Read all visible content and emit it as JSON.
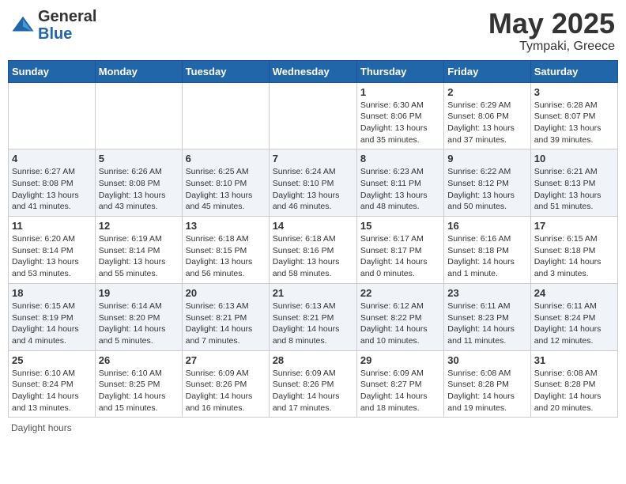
{
  "header": {
    "logo_general": "General",
    "logo_blue": "Blue",
    "title": "May 2025",
    "location": "Tympaki, Greece"
  },
  "days_of_week": [
    "Sunday",
    "Monday",
    "Tuesday",
    "Wednesday",
    "Thursday",
    "Friday",
    "Saturday"
  ],
  "footer": "Daylight hours",
  "weeks": [
    [
      {
        "date": "",
        "sunrise": "",
        "sunset": "",
        "daylight": ""
      },
      {
        "date": "",
        "sunrise": "",
        "sunset": "",
        "daylight": ""
      },
      {
        "date": "",
        "sunrise": "",
        "sunset": "",
        "daylight": ""
      },
      {
        "date": "",
        "sunrise": "",
        "sunset": "",
        "daylight": ""
      },
      {
        "date": "1",
        "sunrise": "Sunrise: 6:30 AM",
        "sunset": "Sunset: 8:06 PM",
        "daylight": "Daylight: 13 hours and 35 minutes."
      },
      {
        "date": "2",
        "sunrise": "Sunrise: 6:29 AM",
        "sunset": "Sunset: 8:06 PM",
        "daylight": "Daylight: 13 hours and 37 minutes."
      },
      {
        "date": "3",
        "sunrise": "Sunrise: 6:28 AM",
        "sunset": "Sunset: 8:07 PM",
        "daylight": "Daylight: 13 hours and 39 minutes."
      }
    ],
    [
      {
        "date": "4",
        "sunrise": "Sunrise: 6:27 AM",
        "sunset": "Sunset: 8:08 PM",
        "daylight": "Daylight: 13 hours and 41 minutes."
      },
      {
        "date": "5",
        "sunrise": "Sunrise: 6:26 AM",
        "sunset": "Sunset: 8:08 PM",
        "daylight": "Daylight: 13 hours and 43 minutes."
      },
      {
        "date": "6",
        "sunrise": "Sunrise: 6:25 AM",
        "sunset": "Sunset: 8:10 PM",
        "daylight": "Daylight: 13 hours and 45 minutes."
      },
      {
        "date": "7",
        "sunrise": "Sunrise: 6:24 AM",
        "sunset": "Sunset: 8:10 PM",
        "daylight": "Daylight: 13 hours and 46 minutes."
      },
      {
        "date": "8",
        "sunrise": "Sunrise: 6:23 AM",
        "sunset": "Sunset: 8:11 PM",
        "daylight": "Daylight: 13 hours and 48 minutes."
      },
      {
        "date": "9",
        "sunrise": "Sunrise: 6:22 AM",
        "sunset": "Sunset: 8:12 PM",
        "daylight": "Daylight: 13 hours and 50 minutes."
      },
      {
        "date": "10",
        "sunrise": "Sunrise: 6:21 AM",
        "sunset": "Sunset: 8:13 PM",
        "daylight": "Daylight: 13 hours and 51 minutes."
      }
    ],
    [
      {
        "date": "11",
        "sunrise": "Sunrise: 6:20 AM",
        "sunset": "Sunset: 8:14 PM",
        "daylight": "Daylight: 13 hours and 53 minutes."
      },
      {
        "date": "12",
        "sunrise": "Sunrise: 6:19 AM",
        "sunset": "Sunset: 8:14 PM",
        "daylight": "Daylight: 13 hours and 55 minutes."
      },
      {
        "date": "13",
        "sunrise": "Sunrise: 6:18 AM",
        "sunset": "Sunset: 8:15 PM",
        "daylight": "Daylight: 13 hours and 56 minutes."
      },
      {
        "date": "14",
        "sunrise": "Sunrise: 6:18 AM",
        "sunset": "Sunset: 8:16 PM",
        "daylight": "Daylight: 13 hours and 58 minutes."
      },
      {
        "date": "15",
        "sunrise": "Sunrise: 6:17 AM",
        "sunset": "Sunset: 8:17 PM",
        "daylight": "Daylight: 14 hours and 0 minutes."
      },
      {
        "date": "16",
        "sunrise": "Sunrise: 6:16 AM",
        "sunset": "Sunset: 8:18 PM",
        "daylight": "Daylight: 14 hours and 1 minute."
      },
      {
        "date": "17",
        "sunrise": "Sunrise: 6:15 AM",
        "sunset": "Sunset: 8:18 PM",
        "daylight": "Daylight: 14 hours and 3 minutes."
      }
    ],
    [
      {
        "date": "18",
        "sunrise": "Sunrise: 6:15 AM",
        "sunset": "Sunset: 8:19 PM",
        "daylight": "Daylight: 14 hours and 4 minutes."
      },
      {
        "date": "19",
        "sunrise": "Sunrise: 6:14 AM",
        "sunset": "Sunset: 8:20 PM",
        "daylight": "Daylight: 14 hours and 5 minutes."
      },
      {
        "date": "20",
        "sunrise": "Sunrise: 6:13 AM",
        "sunset": "Sunset: 8:21 PM",
        "daylight": "Daylight: 14 hours and 7 minutes."
      },
      {
        "date": "21",
        "sunrise": "Sunrise: 6:13 AM",
        "sunset": "Sunset: 8:21 PM",
        "daylight": "Daylight: 14 hours and 8 minutes."
      },
      {
        "date": "22",
        "sunrise": "Sunrise: 6:12 AM",
        "sunset": "Sunset: 8:22 PM",
        "daylight": "Daylight: 14 hours and 10 minutes."
      },
      {
        "date": "23",
        "sunrise": "Sunrise: 6:11 AM",
        "sunset": "Sunset: 8:23 PM",
        "daylight": "Daylight: 14 hours and 11 minutes."
      },
      {
        "date": "24",
        "sunrise": "Sunrise: 6:11 AM",
        "sunset": "Sunset: 8:24 PM",
        "daylight": "Daylight: 14 hours and 12 minutes."
      }
    ],
    [
      {
        "date": "25",
        "sunrise": "Sunrise: 6:10 AM",
        "sunset": "Sunset: 8:24 PM",
        "daylight": "Daylight: 14 hours and 13 minutes."
      },
      {
        "date": "26",
        "sunrise": "Sunrise: 6:10 AM",
        "sunset": "Sunset: 8:25 PM",
        "daylight": "Daylight: 14 hours and 15 minutes."
      },
      {
        "date": "27",
        "sunrise": "Sunrise: 6:09 AM",
        "sunset": "Sunset: 8:26 PM",
        "daylight": "Daylight: 14 hours and 16 minutes."
      },
      {
        "date": "28",
        "sunrise": "Sunrise: 6:09 AM",
        "sunset": "Sunset: 8:26 PM",
        "daylight": "Daylight: 14 hours and 17 minutes."
      },
      {
        "date": "29",
        "sunrise": "Sunrise: 6:09 AM",
        "sunset": "Sunset: 8:27 PM",
        "daylight": "Daylight: 14 hours and 18 minutes."
      },
      {
        "date": "30",
        "sunrise": "Sunrise: 6:08 AM",
        "sunset": "Sunset: 8:28 PM",
        "daylight": "Daylight: 14 hours and 19 minutes."
      },
      {
        "date": "31",
        "sunrise": "Sunrise: 6:08 AM",
        "sunset": "Sunset: 8:28 PM",
        "daylight": "Daylight: 14 hours and 20 minutes."
      }
    ]
  ]
}
